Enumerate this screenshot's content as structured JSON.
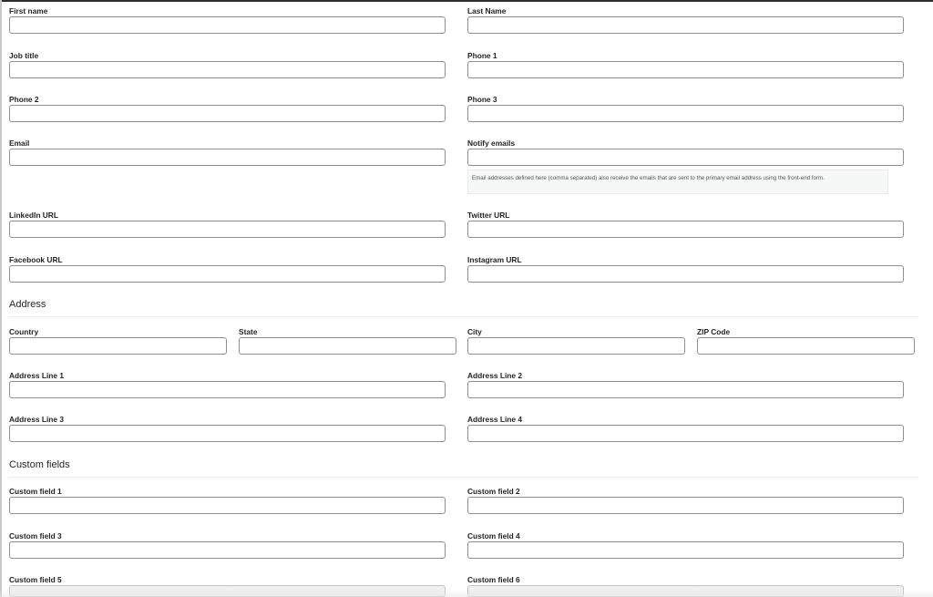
{
  "contact": {
    "first_name": {
      "label": "First name",
      "value": ""
    },
    "last_name": {
      "label": "Last Name",
      "value": ""
    },
    "job_title": {
      "label": "Job title",
      "value": ""
    },
    "phone1": {
      "label": "Phone 1",
      "value": ""
    },
    "phone2": {
      "label": "Phone 2",
      "value": ""
    },
    "phone3": {
      "label": "Phone 3",
      "value": ""
    },
    "email": {
      "label": "Email",
      "value": ""
    },
    "notify_emails": {
      "label": "Notify emails",
      "value": "",
      "description": "Email addresses defined here (comma separated) also receive the emails that are sent to the primary email address using the front-end form."
    },
    "linkedin": {
      "label": "LinkedIn URL",
      "value": ""
    },
    "twitter": {
      "label": "Twitter URL",
      "value": ""
    },
    "facebook": {
      "label": "Facebook URL",
      "value": ""
    },
    "instagram": {
      "label": "Instagram URL",
      "value": ""
    }
  },
  "address": {
    "heading": "Address",
    "country": {
      "label": "Country",
      "value": ""
    },
    "state": {
      "label": "State",
      "value": ""
    },
    "city": {
      "label": "City",
      "value": ""
    },
    "zip": {
      "label": "ZIP Code",
      "value": ""
    },
    "line1": {
      "label": "Address Line 1",
      "value": ""
    },
    "line2": {
      "label": "Address Line 2",
      "value": ""
    },
    "line3": {
      "label": "Address Line 3",
      "value": ""
    },
    "line4": {
      "label": "Address Line 4",
      "value": ""
    }
  },
  "custom": {
    "heading": "Custom fields",
    "f1": {
      "label": "Custom field 1",
      "value": ""
    },
    "f2": {
      "label": "Custom field 2",
      "value": ""
    },
    "f3": {
      "label": "Custom field 3",
      "value": ""
    },
    "f4": {
      "label": "Custom field 4",
      "value": ""
    },
    "f5": {
      "label": "Custom field 5",
      "value": ""
    },
    "f6": {
      "label": "Custom field 6",
      "value": ""
    }
  }
}
